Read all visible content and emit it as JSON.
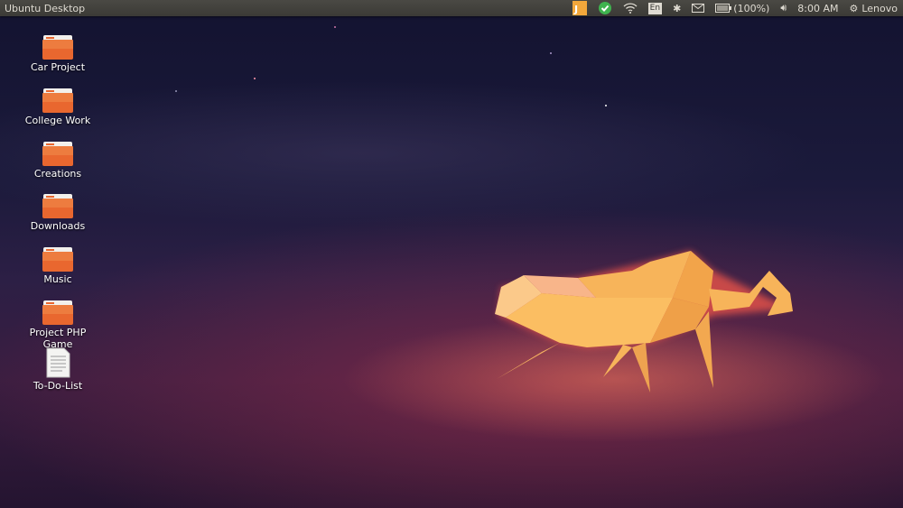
{
  "panel": {
    "title": "Ubuntu Desktop",
    "battery": "(100%)",
    "time": "8:00 AM",
    "user": "Lenovo",
    "keyboard": "En"
  },
  "desktop": {
    "items": [
      {
        "label": "Car Project",
        "type": "folder"
      },
      {
        "label": "College Work",
        "type": "folder"
      },
      {
        "label": "Creations",
        "type": "folder"
      },
      {
        "label": "Downloads",
        "type": "folder"
      },
      {
        "label": "Music",
        "type": "folder"
      },
      {
        "label": "Project PHP Game",
        "type": "folder"
      },
      {
        "label": "To-Do-List",
        "type": "text-file"
      }
    ]
  },
  "colors": {
    "folder": "#e9672f",
    "panel": "#3f3e3a",
    "cat": "#f7b45a"
  }
}
